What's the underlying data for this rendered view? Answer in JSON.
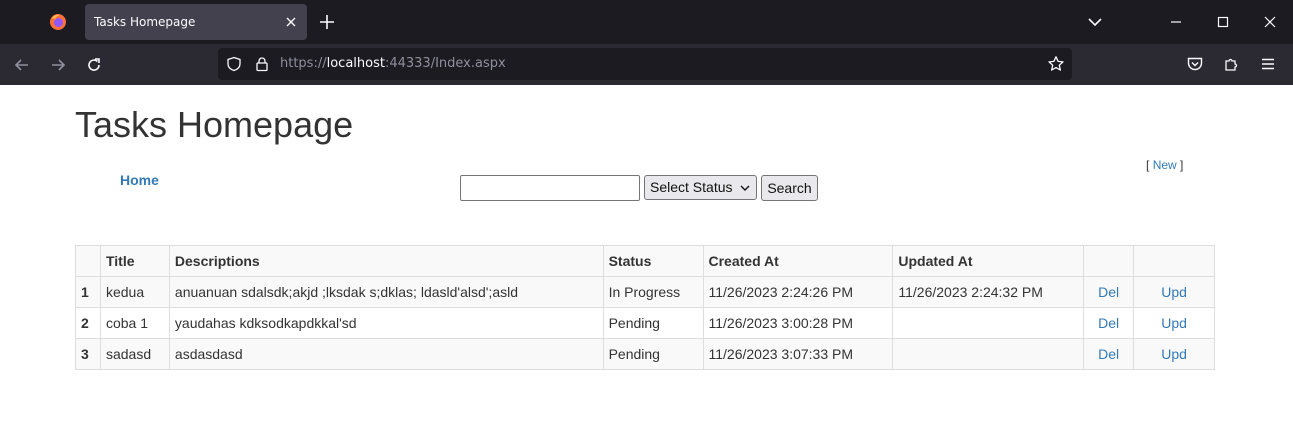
{
  "browser": {
    "tab_title": "Tasks Homepage",
    "url_prefix": "https://",
    "url_host": "localhost",
    "url_rest": ":44333/Index.aspx"
  },
  "page": {
    "title": "Tasks Homepage",
    "new_bracket_open": "[",
    "new_label": "New",
    "new_bracket_close": "]",
    "home_label": "Home",
    "search_value": "",
    "status_select": "Select Status",
    "search_button": "Search"
  },
  "table": {
    "headers": [
      "",
      "Title",
      "Descriptions",
      "Status",
      "Created At",
      "Updated At",
      "",
      ""
    ],
    "rows": [
      {
        "no": "1",
        "title": "kedua",
        "description": "anuanuan sdalsdk;akjd ;lksdak s;dklas; ldasld'alsd';asld",
        "status": "In Progress",
        "created": "11/26/2023 2:24:26 PM",
        "updated": "11/26/2023 2:24:32 PM",
        "del": "Del",
        "upd": "Upd"
      },
      {
        "no": "2",
        "title": "coba 1",
        "description": "yaudahas kdksodkapdkkal'sd",
        "status": "Pending",
        "created": "11/26/2023 3:00:28 PM",
        "updated": "",
        "del": "Del",
        "upd": "Upd"
      },
      {
        "no": "3",
        "title": "sadasd",
        "description": "asdasdasd",
        "status": "Pending",
        "created": "11/26/2023 3:07:33 PM",
        "updated": "",
        "del": "Del",
        "upd": "Upd"
      }
    ]
  },
  "colors": {
    "chrome_dark": "#1c1b22",
    "toolbar": "#2b2a33",
    "link": "#337ab7"
  }
}
